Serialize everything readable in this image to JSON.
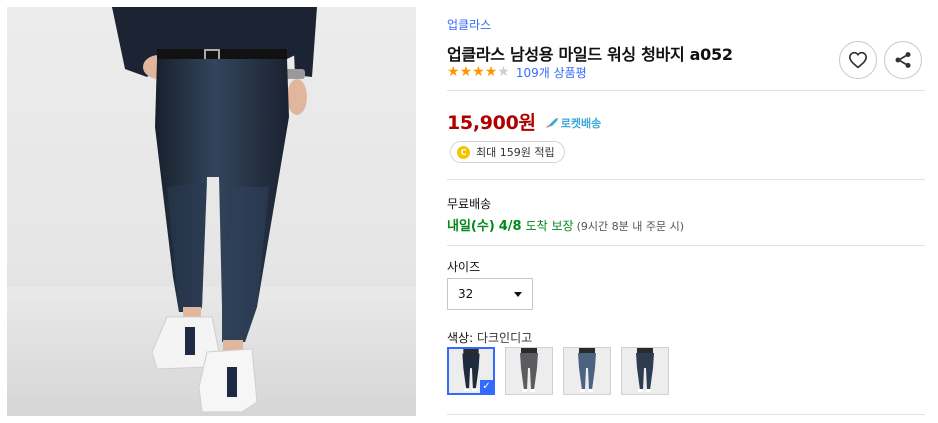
{
  "product": {
    "brand": "업클라스",
    "title": "업클라스 남성용 마일드 워싱 청바지 a052",
    "rating": 4,
    "rating_max": 5,
    "review_count": "109개 상품평",
    "price": "15,900원",
    "rocket_label": "로켓배송",
    "reward_coin": "C",
    "reward_text": "최대 159원 적립"
  },
  "icons": {
    "wishlist": "heart-icon",
    "share": "share-icon",
    "rocket": "rocket-icon",
    "coin": "coin-icon",
    "dropdown": "caret-down-icon",
    "selected": "check-icon"
  },
  "shipping": {
    "label": "무료배송",
    "day": "내일(수)",
    "date": "4/8",
    "guarantee": "도착 보장",
    "condition": "(9시간 8분 내 주문 시)"
  },
  "options": {
    "size_label": "사이즈",
    "size_value": "32",
    "color_label": "색상:",
    "color_value": "다크인디고",
    "swatches": [
      {
        "tone": "#1f2a3c",
        "selected": true
      },
      {
        "tone": "#5a5c60",
        "selected": false
      },
      {
        "tone": "#4a6380",
        "selected": false
      },
      {
        "tone": "#2e3c52",
        "selected": false
      }
    ]
  },
  "colors": {
    "link": "#346aff",
    "price": "#ae0000",
    "delivery": "#00891a",
    "star": "#ff9600",
    "rocket": "#3ea8d8"
  }
}
